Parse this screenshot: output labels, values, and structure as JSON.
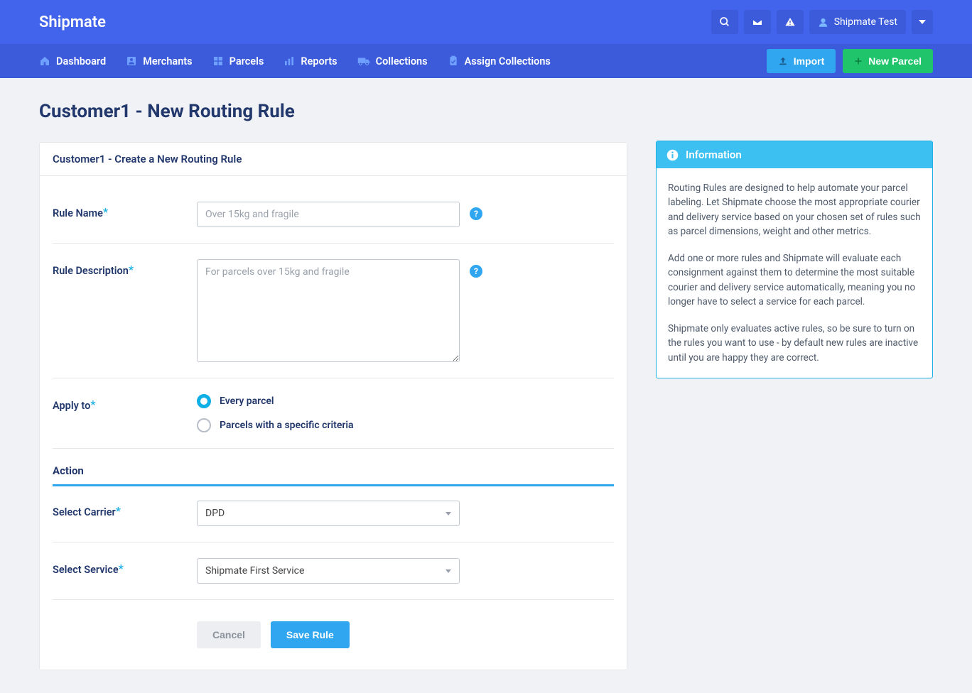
{
  "brand": "Shipmate",
  "user": {
    "name": "Shipmate Test"
  },
  "nav": {
    "items": [
      {
        "label": "Dashboard"
      },
      {
        "label": "Merchants"
      },
      {
        "label": "Parcels"
      },
      {
        "label": "Reports"
      },
      {
        "label": "Collections"
      },
      {
        "label": "Assign Collections"
      }
    ],
    "import_label": "Import",
    "new_parcel_label": "New Parcel"
  },
  "page": {
    "title": "Customer1 - New Routing Rule",
    "card_title": "Customer1 - Create a New Routing Rule"
  },
  "form": {
    "rule_name": {
      "label": "Rule Name",
      "placeholder": "Over 15kg and fragile",
      "value": ""
    },
    "rule_description": {
      "label": "Rule Description",
      "placeholder": "For parcels over 15kg and fragile",
      "value": ""
    },
    "apply_to": {
      "label": "Apply to",
      "options": [
        {
          "label": "Every parcel",
          "checked": true
        },
        {
          "label": "Parcels with a specific criteria",
          "checked": false
        }
      ]
    },
    "action_heading": "Action",
    "select_carrier": {
      "label": "Select Carrier",
      "value": "DPD"
    },
    "select_service": {
      "label": "Select Service",
      "value": "Shipmate First Service"
    },
    "cancel_label": "Cancel",
    "save_label": "Save Rule"
  },
  "info": {
    "title": "Information",
    "paragraphs": [
      "Routing Rules are designed to help automate your parcel labeling. Let Shipmate choose the most appropriate courier and delivery service based on your chosen set of rules such as parcel dimensions, weight and other metrics.",
      "Add one or more rules and Shipmate will evaluate each consignment against them to determine the most suitable courier and delivery service automatically, meaning you no longer have to select a service for each parcel.",
      "Shipmate only evaluates active rules, so be sure to turn on the rules you want to use - by default new rules are inactive until you are happy they are correct."
    ]
  }
}
